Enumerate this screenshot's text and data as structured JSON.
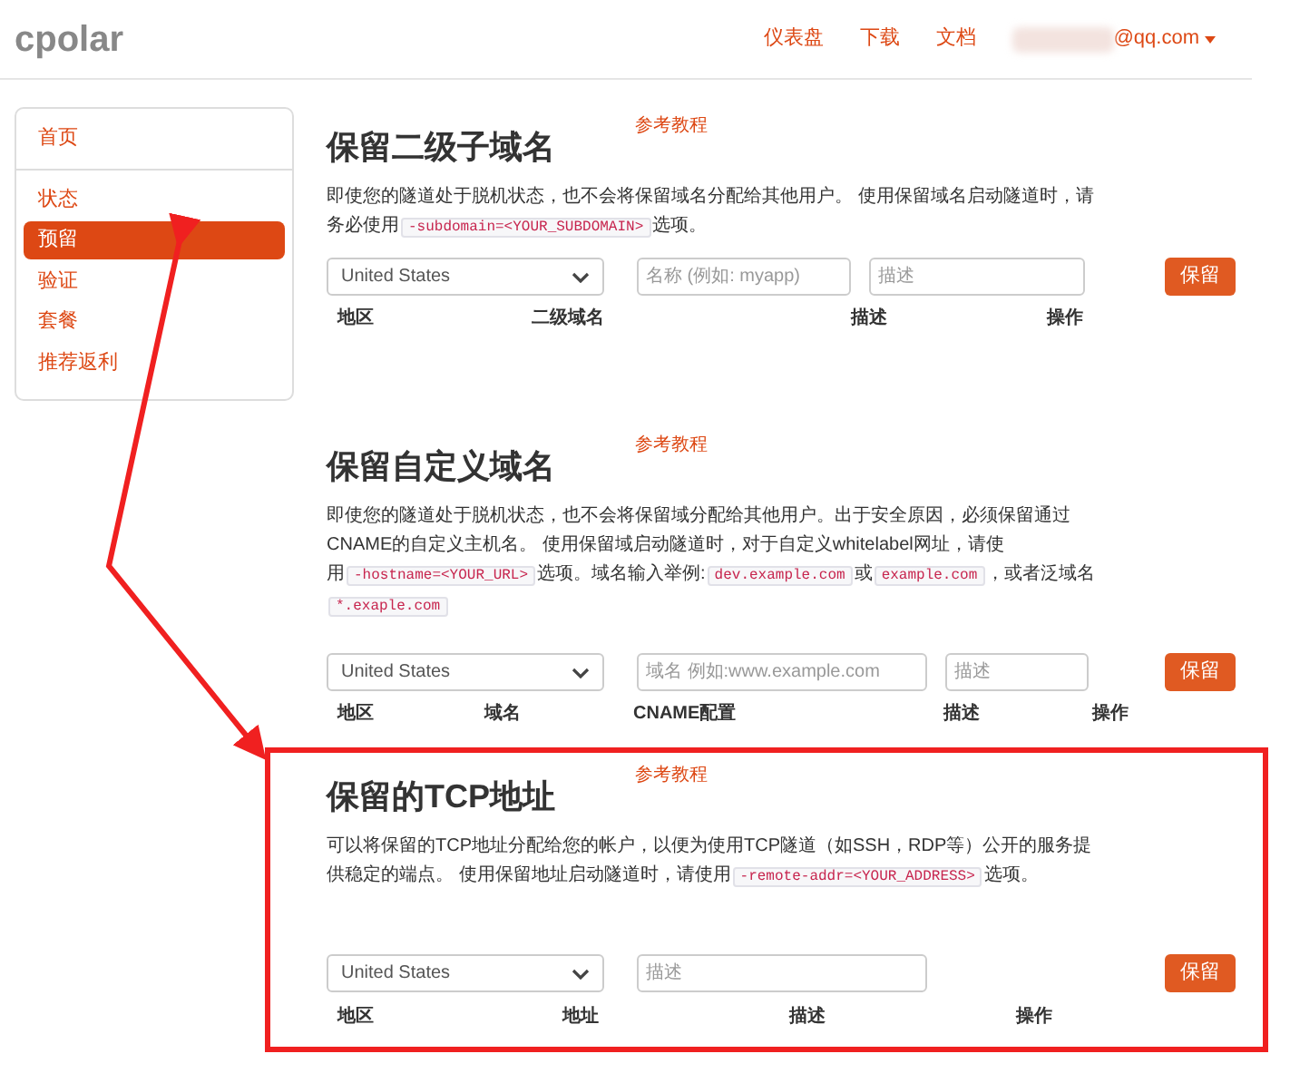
{
  "header": {
    "logo": "cpolar",
    "nav": [
      {
        "label": "仪表盘"
      },
      {
        "label": "下载"
      },
      {
        "label": "文档"
      }
    ],
    "account": "@qq.com"
  },
  "sidebar": {
    "groups": [
      [
        {
          "label": "首页",
          "selected": false
        }
      ],
      [
        {
          "label": "状态",
          "selected": false
        },
        {
          "label": "预留",
          "selected": true
        },
        {
          "label": "验证",
          "selected": false
        },
        {
          "label": "套餐",
          "selected": false
        },
        {
          "label": "推荐返利",
          "selected": false
        }
      ]
    ]
  },
  "sections": [
    {
      "title": "保留二级子域名",
      "link": "参考教程",
      "highlighted": false,
      "description": [
        {
          "kind": "text",
          "text": "即使您的隧道处于脱机状态，也不会将保留域名分配给其他用户。 使用保留域名启动隧道时，请务必使用"
        },
        {
          "kind": "code",
          "text": "-subdomain=<YOUR_SUBDOMAIN>"
        },
        {
          "kind": "text",
          "text": "选项。"
        }
      ],
      "region": "United States",
      "fields": [
        {
          "placeholder": "名称 (例如: myapp)"
        },
        {
          "placeholder": "描述"
        }
      ],
      "button": "保留",
      "columns": [
        "地区",
        "二级域名",
        "描述",
        "操作"
      ]
    },
    {
      "title": "保留自定义域名",
      "link": "参考教程",
      "highlighted": false,
      "description": [
        {
          "kind": "text",
          "text": "即使您的隧道处于脱机状态，也不会将保留域分配给其他用户。出于安全原因，必须保留通过CNAME的自定义主机名。 使用保留域启动隧道时，对于自定义whitelabel网址，请使用"
        },
        {
          "kind": "code",
          "text": "-hostname=<YOUR_URL>"
        },
        {
          "kind": "text",
          "text": "选项。域名输入举例:"
        },
        {
          "kind": "code",
          "text": "dev.example.com"
        },
        {
          "kind": "text",
          "text": "或"
        },
        {
          "kind": "code",
          "text": "example.com"
        },
        {
          "kind": "text",
          "text": "，或者泛域名"
        },
        {
          "kind": "code",
          "text": "*.exaple.com"
        }
      ],
      "region": "United States",
      "fields": [
        {
          "placeholder": "域名 例如:www.example.com"
        },
        {
          "placeholder": "描述"
        }
      ],
      "button": "保留",
      "columns": [
        "地区",
        "域名",
        "CNAME配置",
        "描述",
        "操作"
      ]
    },
    {
      "title": "保留的TCP地址",
      "link": "参考教程",
      "highlighted": true,
      "description": [
        {
          "kind": "text",
          "text": "可以将保留的TCP地址分配给您的帐户，以便为使用TCP隧道（如SSH，RDP等）公开的服务提供稳定的端点。 使用保留地址启动隧道时，请使用"
        },
        {
          "kind": "code",
          "text": "-remote-addr=<YOUR_ADDRESS>"
        },
        {
          "kind": "text",
          "text": "选项。"
        }
      ],
      "region": "United States",
      "fields": [
        {
          "placeholder": "描述"
        }
      ],
      "button": "保留",
      "columns": [
        "地区",
        "地址",
        "描述",
        "操作"
      ]
    }
  ]
}
